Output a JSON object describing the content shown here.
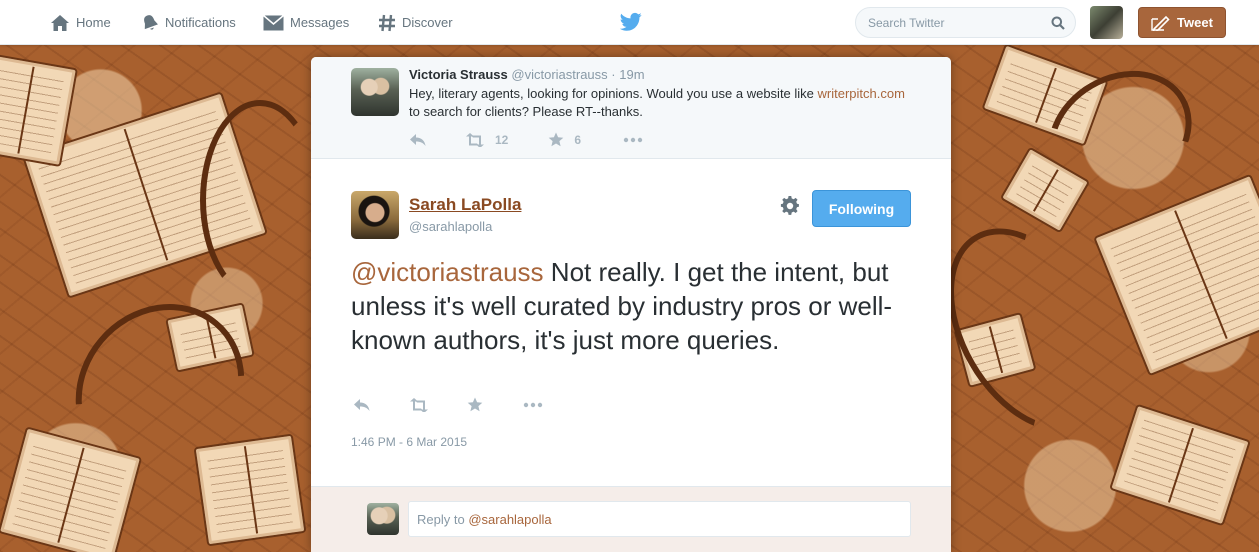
{
  "nav": {
    "home": "Home",
    "notifications": "Notifications",
    "messages": "Messages",
    "discover": "Discover"
  },
  "search": {
    "placeholder": "Search Twitter"
  },
  "tweet_button": "Tweet",
  "ancestor_tweet": {
    "name": "Victoria Strauss",
    "handle": "@victoriastrauss",
    "separator": "·",
    "time": "19m",
    "text_before_link": "Hey, literary agents, looking for opinions. Would you use a website like",
    "link": "writerpitch.com",
    "text_after_link": "to search for clients? Please RT--thanks.",
    "retweets": "12",
    "favorites": "6"
  },
  "main_tweet": {
    "name": "Sarah LaPolla",
    "handle": "@sarahlapolla",
    "follow_label": "Following",
    "mention": "@victoriastrauss",
    "text": "Not really. I get the intent, but unless it's well curated by industry pros or well-known authors, it's just more queries.",
    "timestamp": "1:46 PM - 6 Mar 2015"
  },
  "reply": {
    "prefix": "Reply to",
    "mention": "@sarahlapolla"
  },
  "colors": {
    "accent": "#a8663c",
    "follow_blue": "#55acee",
    "twitter_bird": "#55acee",
    "background": "#a8602e"
  },
  "icons": {
    "home": "home-icon",
    "notifications": "bell-icon",
    "messages": "envelope-icon",
    "discover": "hash-icon",
    "search": "search-icon",
    "compose": "compose-icon",
    "reply": "reply-icon",
    "retweet": "retweet-icon",
    "favorite": "star-icon",
    "more": "more-icon",
    "gear": "gear-icon"
  }
}
